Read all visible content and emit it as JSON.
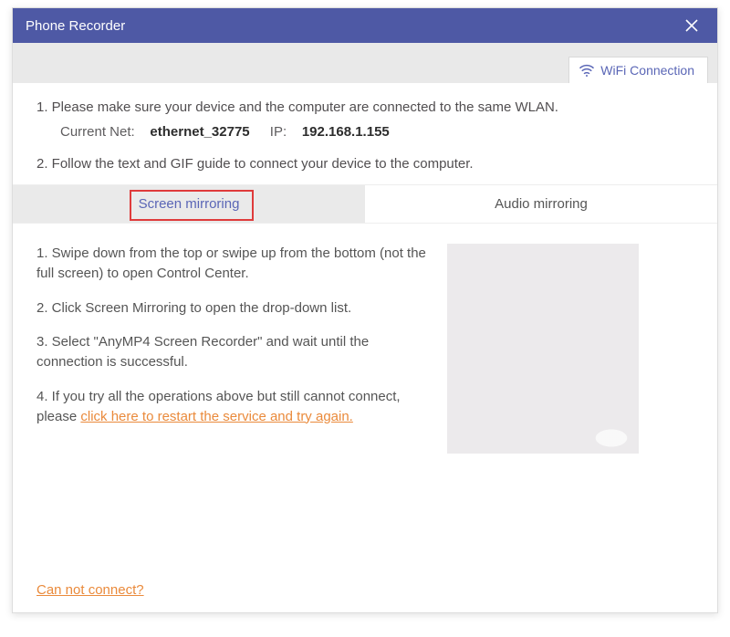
{
  "window": {
    "title": "Phone Recorder"
  },
  "wifi_tab_label": "WiFi Connection",
  "intro": {
    "line1": "1. Please make sure your device and the computer are connected to the same WLAN.",
    "net": {
      "label": "Current Net:",
      "value": "ethernet_32775",
      "ip_label": "IP:",
      "ip_value": "192.168.1.155"
    },
    "line2": "2. Follow the text and GIF guide to connect your device to the computer."
  },
  "tabs": {
    "screen": "Screen mirroring",
    "audio": "Audio mirroring"
  },
  "steps": {
    "s1": "1. Swipe down from the top or swipe up from the bottom (not the full screen) to open Control Center.",
    "s2": "2. Click Screen Mirroring to open the drop-down list.",
    "s3": "3. Select \"AnyMP4 Screen Recorder\" and wait until the connection is successful.",
    "s4_prefix": "4. If you try all the operations above but still cannot connect, please ",
    "s4_link": "click here to restart the service and try again."
  },
  "footer_link": "Can not connect?"
}
